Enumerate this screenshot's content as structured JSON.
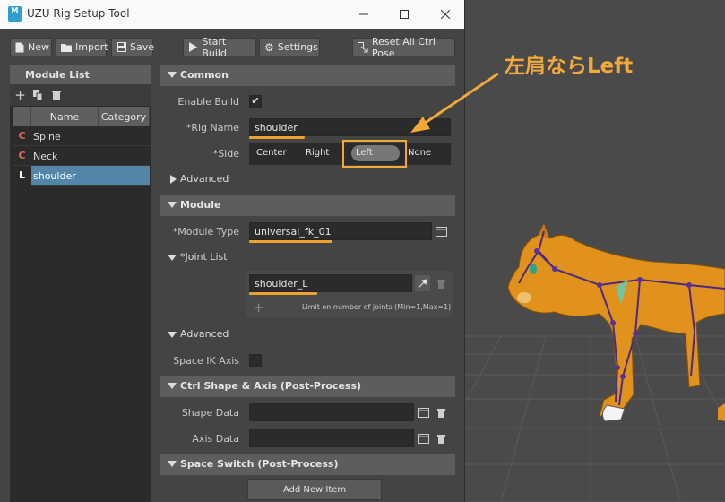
{
  "window": {
    "title": "UZU Rig Setup Tool",
    "app_icon": "M"
  },
  "toolbar": {
    "new_label": "New",
    "import_label": "Import",
    "save_label": "Save",
    "start_build_label": "Start Build",
    "settings_label": "Settings",
    "reset_label": "Reset All Ctrl Pose"
  },
  "module_list": {
    "title": "Module List",
    "columns": [
      "Name",
      "Category"
    ],
    "rows": [
      {
        "mark": "C",
        "name": "Spine",
        "category": "",
        "mark_color": "#e06a5a"
      },
      {
        "mark": "C",
        "name": "Neck",
        "category": "",
        "mark_color": "#e06a5a"
      },
      {
        "mark": "L",
        "name": "shoulder",
        "category": "",
        "mark_color": "#ffffff",
        "selected": true
      }
    ]
  },
  "common": {
    "title": "Common",
    "enable_build_label": "Enable Build",
    "enable_build": true,
    "rig_name_label": "*Rig Name",
    "rig_name_value": "shoulder",
    "side_label": "*Side",
    "side_options": [
      "Center",
      "Right",
      "Left",
      "None"
    ],
    "side_selected": "Left",
    "advanced_label": "Advanced"
  },
  "module": {
    "title": "Module",
    "module_type_label": "*Module Type",
    "module_type_value": "universal_fk_01",
    "joint_list_label": "*Joint List",
    "joint_value": "shoulder_L",
    "joint_limit_text": "Limit on number of joints (Min=1,Max=1)",
    "advanced_label": "Advanced",
    "space_ik_axis_label": "Space IK Axis"
  },
  "ctrl_shape": {
    "title": "Ctrl Shape & Axis (Post-Process)",
    "shape_data_label": "Shape Data",
    "axis_data_label": "Axis Data"
  },
  "space_switch": {
    "title": "Space Switch (Post-Process)",
    "add_item_label": "Add New Item"
  },
  "annotation": {
    "text": "左肩ならLeft",
    "color": "#f2a93a"
  }
}
